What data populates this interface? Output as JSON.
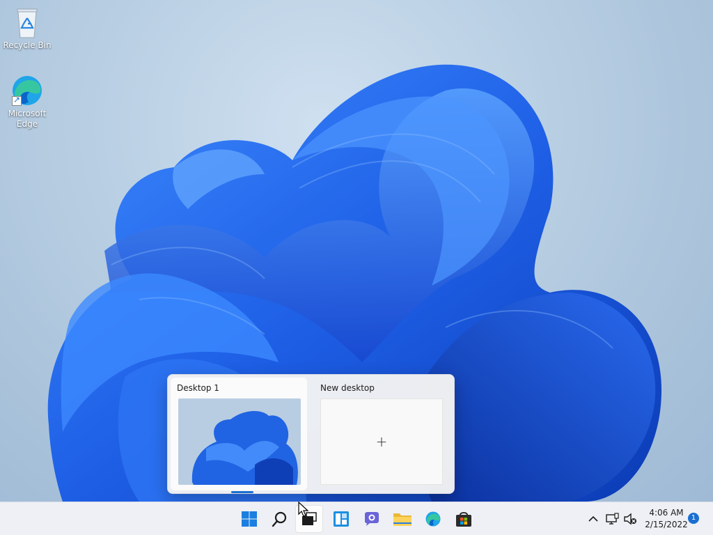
{
  "desktop": {
    "icons": [
      {
        "label": "Recycle Bin",
        "icon": "recycle-bin-icon"
      },
      {
        "label": "Microsoft Edge",
        "icon": "edge-icon"
      }
    ]
  },
  "taskview": {
    "desktops": [
      {
        "title": "Desktop 1",
        "active": true
      },
      {
        "title": "New desktop",
        "add_symbol": "+"
      }
    ]
  },
  "taskbar": {
    "buttons": [
      {
        "name": "start",
        "icon": "windows-logo-icon"
      },
      {
        "name": "search",
        "icon": "search-icon"
      },
      {
        "name": "task-view",
        "icon": "task-view-icon"
      },
      {
        "name": "widgets",
        "icon": "widgets-icon"
      },
      {
        "name": "chat",
        "icon": "teams-chat-icon"
      },
      {
        "name": "file-explorer",
        "icon": "folder-icon"
      },
      {
        "name": "edge",
        "icon": "edge-icon"
      },
      {
        "name": "store",
        "icon": "store-icon"
      }
    ],
    "tray": {
      "overflow_icon": "chevron-up-icon",
      "network_icon": "network-icon",
      "volume_icon": "volume-muted-icon",
      "time": "4:06 AM",
      "date": "2/15/2022",
      "notification_count": "1"
    }
  },
  "colors": {
    "accent": "#1a6fd1",
    "bloom": "#1f5fe0"
  }
}
